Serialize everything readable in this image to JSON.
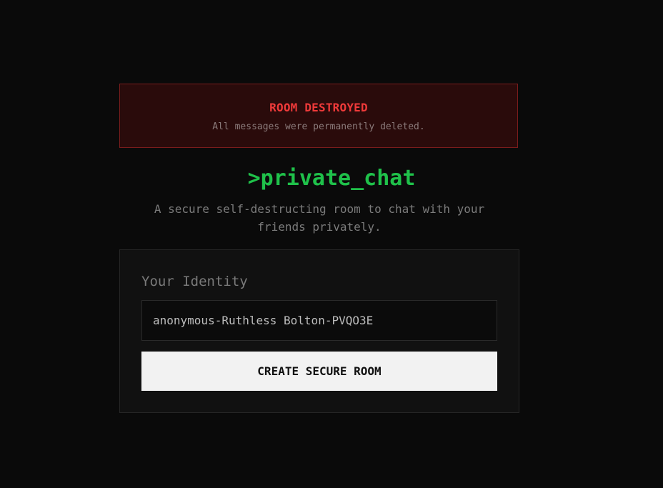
{
  "alert": {
    "title": "ROOM DESTROYED",
    "message": "All messages were permanently deleted."
  },
  "brand": {
    "logo_text": ">private_chat",
    "tagline": "A secure self-destructing room to chat with your friends privately."
  },
  "form": {
    "identity_label": "Your Identity",
    "identity_value": "anonymous-Ruthless Bolton-PVQO3E",
    "create_button_label": "CREATE SECURE ROOM"
  },
  "colors": {
    "background": "#0a0a0a",
    "alert_text": "#ef3a3a",
    "alert_border": "#7a1c1c",
    "brand_green": "#1fc14a",
    "button_bg": "#f2f2f2"
  }
}
